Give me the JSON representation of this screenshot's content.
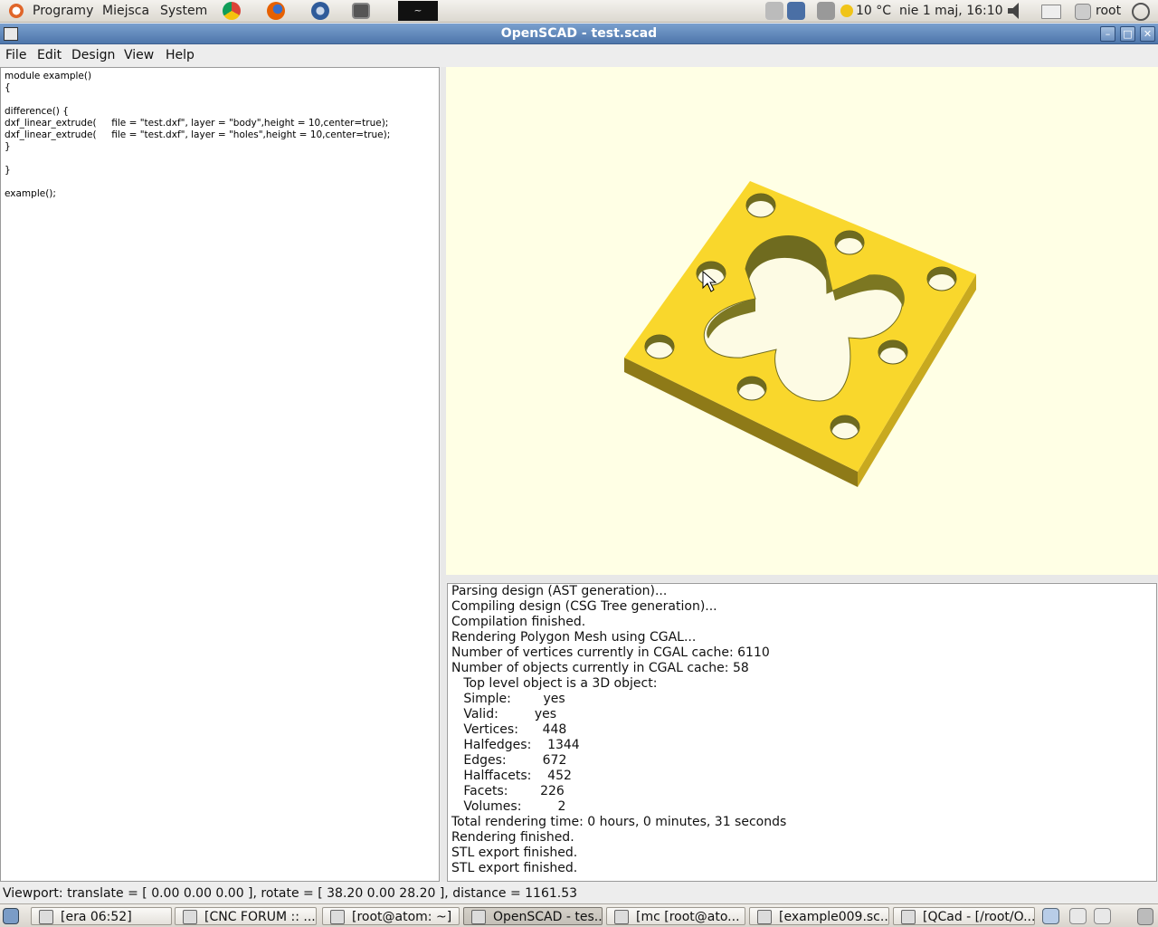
{
  "top_panel": {
    "menus": [
      "Programy",
      "Miejsca",
      "System"
    ],
    "launcher_icons": [
      "chrome-icon",
      "firefox-icon",
      "thunderbird-icon",
      "monitor-icon",
      "liquid-icon"
    ],
    "weather": "10 °C",
    "clock": "nie  1 maj, 16:10",
    "user": "root"
  },
  "window": {
    "title": "OpenSCAD - test.scad"
  },
  "menubar": [
    "File",
    "Edit",
    "Design",
    "View",
    "Help"
  ],
  "editor": {
    "code": "module example()\n{\n\ndifference() {\ndxf_linear_extrude(     file = \"test.dxf\", layer = \"body\",height = 10,center=true);\ndxf_linear_extrude(     file = \"test.dxf\", layer = \"holes\",height = 10,center=true);\n}\n\n}\n\nexample();"
  },
  "console": {
    "lines": [
      "Parsing design (AST generation)...",
      "Compiling design (CSG Tree generation)...",
      "Compilation finished.",
      "Rendering Polygon Mesh using CGAL...",
      "Number of vertices currently in CGAL cache: 6110",
      "Number of objects currently in CGAL cache: 58",
      "   Top level object is a 3D object:",
      "   Simple:        yes",
      "   Valid:         yes",
      "   Vertices:      448",
      "   Halfedges:    1344",
      "   Edges:         672",
      "   Halffacets:    452",
      "   Facets:        226",
      "   Volumes:         2",
      "Total rendering time: 0 hours, 0 minutes, 31 seconds",
      "Rendering finished.",
      "STL export finished.",
      "STL export finished."
    ]
  },
  "statusbar": {
    "text": "Viewport: translate = [ 0.00 0.00 0.00 ], rotate = [ 38.20 0.00 28.20 ], distance = 1161.53"
  },
  "taskbar": {
    "tasks": [
      {
        "label": "[era 06:52]",
        "icon": "mail-icon"
      },
      {
        "label": "[CNC FORUM :: ...",
        "icon": "chrome-icon"
      },
      {
        "label": "[root@atom: ~]",
        "icon": "terminal-icon"
      },
      {
        "label": "OpenSCAD - tes...",
        "icon": "window-icon"
      },
      {
        "label": "[mc [root@ato...",
        "icon": "terminal-icon"
      },
      {
        "label": "[example009.sc...",
        "icon": "editor-icon"
      },
      {
        "label": "[QCad - [/root/O...",
        "icon": "qcad-icon"
      }
    ]
  },
  "colors": {
    "viewport_bg": "#ffffe5",
    "model_face": "#f9d72c",
    "model_side": "#c8a91f",
    "hole_wall": "#6f6b1f"
  }
}
